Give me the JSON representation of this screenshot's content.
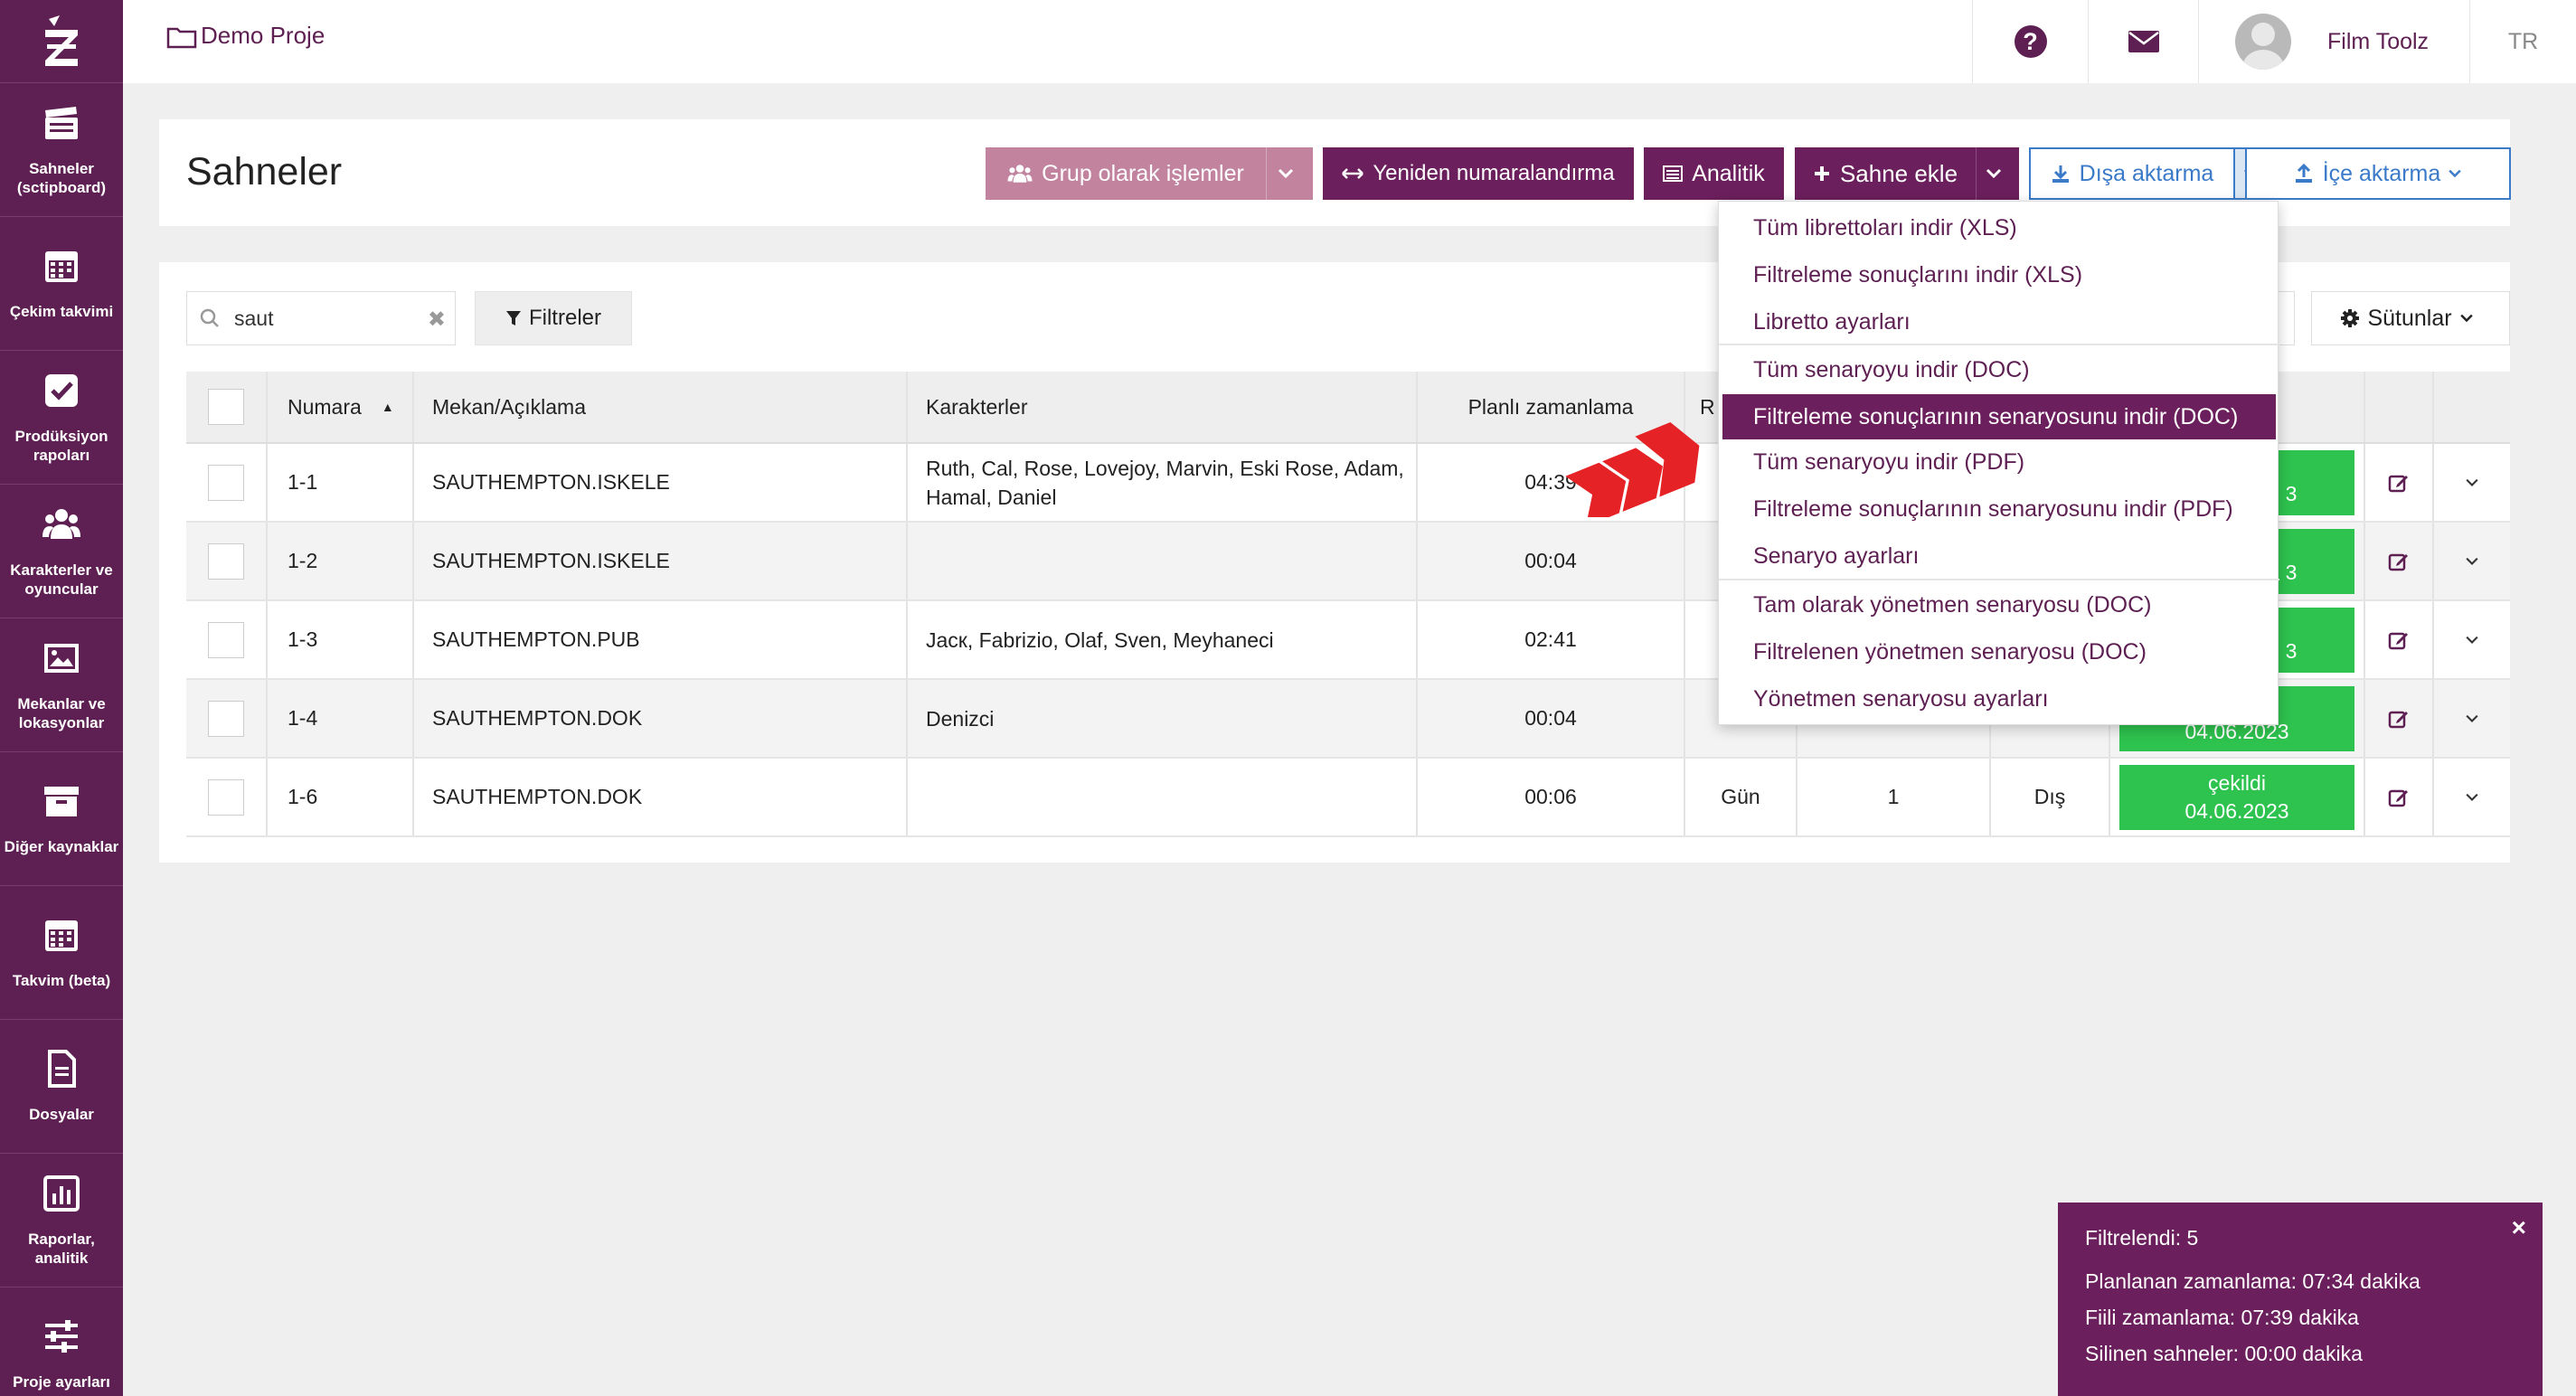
{
  "sidebar": {
    "items": [
      {
        "label": "Sahneler (sctipboard)",
        "icon": "clapperboard-icon"
      },
      {
        "label": "Çekim takvimi",
        "icon": "calendar-icon"
      },
      {
        "label": "Prodüksiyon rapoları",
        "icon": "checkbox-icon"
      },
      {
        "label": "Karakterler ve oyuncular",
        "icon": "users-icon"
      },
      {
        "label": "Mekanlar ve lokasyonlar",
        "icon": "image-icon"
      },
      {
        "label": "Diğer kaynaklar",
        "icon": "archive-icon"
      },
      {
        "label": "Takvim (beta)",
        "icon": "calendar-grid-icon"
      },
      {
        "label": "Dosyalar",
        "icon": "file-icon"
      },
      {
        "label": "Raporlar, analitik",
        "icon": "bar-chart-icon"
      },
      {
        "label": "Proje ayarları",
        "icon": "sliders-icon"
      }
    ]
  },
  "topbar": {
    "project": "Demo Proje",
    "user_name": "Film Toolz",
    "lang": "TR"
  },
  "header": {
    "title": "Sahneler",
    "btn_grup": "Grup olarak işlemler",
    "btn_yeniden": "Yeniden numaralandırma",
    "btn_analitik": "Analitik",
    "btn_sahne": "Sahne ekle",
    "btn_disa": "Dışa aktarma",
    "btn_ice": "İçe aktarma"
  },
  "toolbar": {
    "search_value": "saut",
    "filters": "Filtreler",
    "columns": "Sütunlar"
  },
  "table": {
    "headers": {
      "numara": "Numara",
      "mekan": "Mekan/Açıklama",
      "karakterler": "Karakterler",
      "zamanlama": "Planlı zamanlama",
      "r": "R"
    },
    "rows": [
      {
        "num": "1-1",
        "mekan": "SAUTHEMPTON.ISKELE",
        "kar": "Ruth, Cal, Rose, Lovejoy, Marvin, Eski Rose, Adam, Hamal, Daniel",
        "zam": "04:39",
        "status_bottom": "3"
      },
      {
        "num": "1-2",
        "mekan": "SAUTHEMPTON.ISKELE",
        "kar": "",
        "zam": "00:04",
        "status_bottom": "3"
      },
      {
        "num": "1-3",
        "mekan": "SAUTHEMPTON.PUB",
        "kar": "Jacк, Fabrizio, Olaf, Sven, Meyhaneci",
        "zam": "02:41",
        "status_bottom": "3"
      },
      {
        "num": "1-4",
        "mekan": "SAUTHEMPTON.DOK",
        "kar": "Denizci",
        "zam": "00:04",
        "status_bottom": "04.06.2023"
      },
      {
        "num": "1-6",
        "mekan": "SAUTHEMPTON.DOK",
        "kar": "",
        "zam": "00:06",
        "gun": "Gün",
        "bir": "1",
        "dis": "Dış",
        "status_top": "çekildi",
        "status_bottom": "04.06.2023"
      }
    ]
  },
  "export_menu": {
    "items": [
      "Tüm librettoları indir (XLS)",
      "Filtreleme sonuçlarını indir (XLS)",
      "Libretto ayarları",
      "Tüm senaryoyu indir (DOC)",
      "Filtreleme sonuçlarının senaryosunu indir (DOC)",
      "Tüm senaryoyu indir (PDF)",
      "Filtreleme sonuçlarının senaryosunu indir (PDF)",
      "Senaryo ayarları",
      "Tam olarak yönetmen senaryosu (DOC)",
      "Filtrelenen yönetmen senaryosu (DOC)",
      "Yönetmen senaryosu ayarları"
    ],
    "active_index": 4
  },
  "toast": {
    "line1": "Filtrelendi: 5",
    "line2": "Planlanan zamanlama: 07:34 dakika",
    "line3": "Fiili zamanlama: 07:39 dakika",
    "line4": "Silinen sahneler: 00:00 dakika",
    "close": "×"
  },
  "colors": {
    "brand": "#5e2052",
    "accent_blue": "#3a7ac8",
    "success": "#2ec24e"
  }
}
